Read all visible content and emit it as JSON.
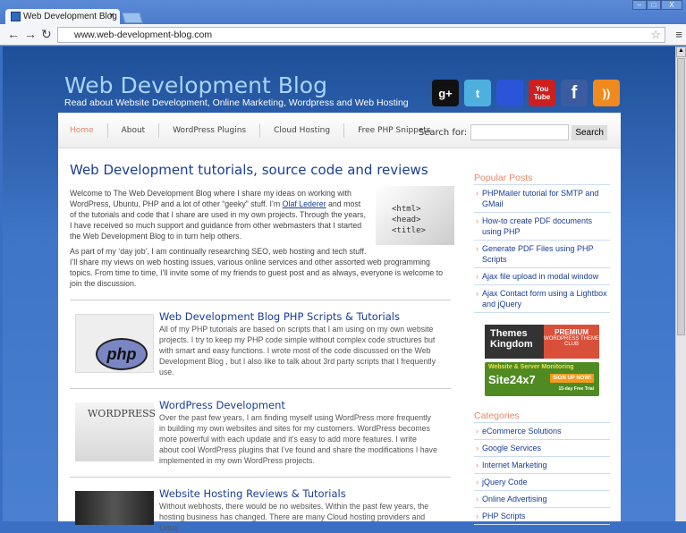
{
  "browser": {
    "tab_title": "Web Development Blog",
    "url": "www.web-development-blog.com",
    "min": "–",
    "max": "□",
    "close": "X",
    "tab_close": "×"
  },
  "header": {
    "title": "Web Development Blog",
    "tagline": "Read about Website Development, Online Marketing, Wordpress and Web Hosting",
    "social": [
      {
        "name": "google-plus",
        "label": "g+",
        "color": "#111111"
      },
      {
        "name": "twitter",
        "label": "t",
        "color": "#4fb0e0"
      },
      {
        "name": "delicious",
        "label": "",
        "color": "#2a55d8"
      },
      {
        "name": "youtube",
        "label": "You Tube",
        "color": "#cc1f1f"
      },
      {
        "name": "facebook",
        "label": "f",
        "color": "#3b5ca0"
      },
      {
        "name": "rss",
        "label": "))",
        "color": "#f08a1c"
      }
    ]
  },
  "nav": {
    "items": [
      "Home",
      "About",
      "WordPress Plugins",
      "Cloud Hosting",
      "Free PHP Snippets"
    ],
    "search_label": "Search for:",
    "search_value": "",
    "search_button": "Search"
  },
  "main": {
    "heading": "Web Development tutorials, source code and reviews",
    "intro1_a": "Welcome to The Web Development Blog where I share my ideas on working with WordPress, Ubuntu, PHP and a lot of other “geeky” stuff. I’m ",
    "intro1_link": "Olaf Lederer",
    "intro1_b": " and most of the tutorials and code that I share are used in my own projects. Through the years, I have received so much support and guidance from other webmasters that I started the Web Development Blog to in turn help others.",
    "intro2": "As part of my ‘day job’, I am continually researching SEO, web hosting and tech stuff. I’ll share my views on web hosting issues, various online services and other assorted web programming topics. From time to time, I’ll invite some of my friends to guest post and as always, everyone is welcome to join the discussion.",
    "intro_image_text": "<html> <head> <title>",
    "posts": [
      {
        "title": "Web Development Blog PHP Scripts & Tutorials",
        "body": "All of my PHP tutorials are based on scripts that I am using on my own website projects. I try to keep my PHP code simple without complex code structures but with smart and easy functions. I wrote most of the code discussed on the Web Development Blog , but I also like to talk about 3rd party scripts that I frequently use.",
        "thumb": "php"
      },
      {
        "title": "WordPress Development",
        "body": "Over the past few years, I am finding myself using WordPress more frequently in building my own websites and sites for my customers. WordPress becomes more powerful with each update and it’s easy to add more features. I write about cool WordPress plugins that I’ve found and share the modifications I have implemented in my own WordPress projects.",
        "thumb": "WORDPRESS"
      },
      {
        "title": "Website Hosting Reviews & Tutorials",
        "body": "Without webhosts, there would be no websites. Within the past few years, the hosting business has changed. There are many Cloud hosting providers and Linux",
        "thumb": ""
      }
    ]
  },
  "sidebar": {
    "popular_title": "Popular Posts",
    "popular": [
      "PHPMailer tutorial for SMTP and GMail",
      "How-to create PDF documents using PHP",
      "Generate PDF Files using PHP Scripts",
      "Ajax file upload in modal window",
      "Ajax Contact form using a Lightbox and jQuery"
    ],
    "ad1": {
      "left": "Themes Kingdom",
      "right1": "PREMIUM",
      "right2": "WORDPRESS THEME CLUB"
    },
    "ad2": {
      "top": "Website & Server Monitoring",
      "brand": "Site24x7",
      "cta": "SIGN UP NOW!",
      "sub": "15-day Free Trial"
    },
    "categories_title": "Categories",
    "categories": [
      "eCommerce Solutions",
      "Google Services",
      "Internet Marketing",
      "jQuery Code",
      "Online Advertising",
      "PHP Scripts"
    ]
  }
}
